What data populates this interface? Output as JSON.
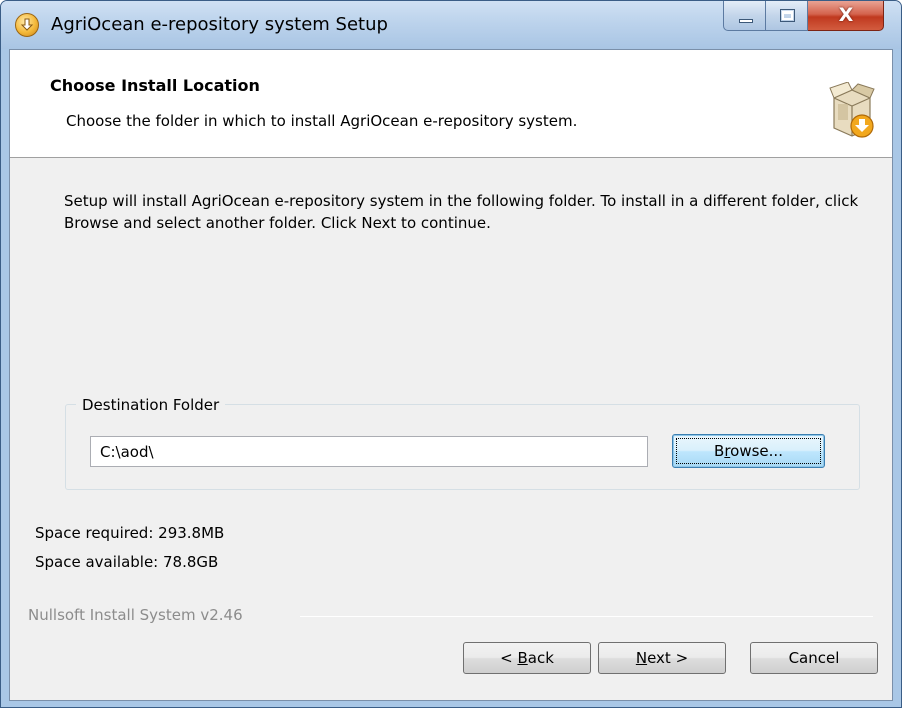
{
  "window": {
    "title": "AgriOcean e-repository system Setup",
    "app_icon": "installer-download-icon",
    "controls": {
      "minimize_icon": "minimize-icon",
      "maximize_icon": "maximize-icon",
      "close_glyph": "X"
    }
  },
  "header": {
    "title": "Choose Install Location",
    "subtitle": "Choose the folder in which to install AgriOcean e-repository system.",
    "icon": "box-install-icon"
  },
  "body": {
    "intro": "Setup will install AgriOcean e-repository system in the following folder. To install in a different folder, click Browse and select another folder. Click Next to continue."
  },
  "destination": {
    "legend": "Destination Folder",
    "path": "C:\\aod\\",
    "browse": {
      "pre": "B",
      "accel": "r",
      "post": "owse..."
    }
  },
  "space": {
    "required": "Space required: 293.8MB",
    "available": "Space available: 78.8GB"
  },
  "branding": "Nullsoft Install System v2.46",
  "buttons": {
    "back": {
      "pre": "< ",
      "accel": "B",
      "post": "ack"
    },
    "next": {
      "accel": "N",
      "post": "ext >"
    },
    "cancel": "Cancel"
  },
  "colors": {
    "title_bar": "#bcd3ec",
    "close_button": "#c0391f",
    "dialog_bg": "#f0f0f0",
    "header_bg": "#ffffff",
    "focused_button": "#bee6fd"
  }
}
